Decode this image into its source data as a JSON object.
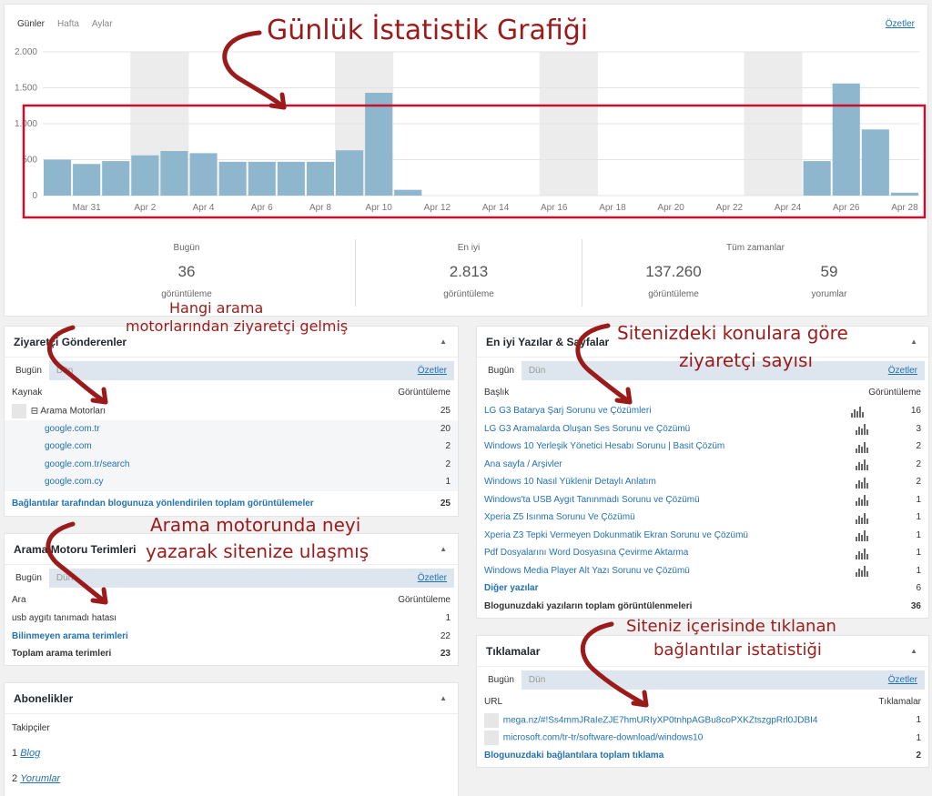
{
  "chart": {
    "range_tabs": [
      "Günler",
      "Hafta",
      "Aylar"
    ],
    "summaries_link": "Özetler",
    "chart_data": {
      "type": "bar",
      "y_ticks": [
        "2.000",
        "1.500",
        "1.000",
        "500",
        "0"
      ],
      "ylim": [
        0,
        2000
      ],
      "x_tick_labels": [
        "Mar 31",
        "Apr 2",
        "Apr 4",
        "Apr 6",
        "Apr 8",
        "Apr 10",
        "Apr 12",
        "Apr 14",
        "Apr 16",
        "Apr 18",
        "Apr 20",
        "Apr 22",
        "Apr 24",
        "Apr 26",
        "Apr 28"
      ],
      "values": [
        500,
        440,
        480,
        560,
        620,
        590,
        470,
        470,
        470,
        470,
        630,
        1430,
        80,
        0,
        0,
        0,
        0,
        0,
        0,
        0,
        0,
        0,
        0,
        0,
        0,
        0,
        480,
        1560,
        920,
        40
      ],
      "grid": true,
      "bar_color": "#8eb6cc",
      "weekend_shade_color": "#ececec",
      "highlight_box_color": "#c8102e"
    },
    "stats": {
      "today_label": "Bugün",
      "today_value": "36",
      "today_unit": "görüntüleme",
      "best_label": "En iyi",
      "best_value": "2.813",
      "best_unit": "görüntüleme",
      "all_label": "Tüm zamanlar",
      "all_views_value": "137.260",
      "all_views_unit": "görüntüleme",
      "all_comments_value": "59",
      "all_comments_unit": "yorumlar"
    }
  },
  "referrers": {
    "title": "Ziyaretçi Gönderenler",
    "tab_today": "Bugün",
    "tab_yesterday": "Dün",
    "summaries": "Özetler",
    "col_source": "Kaynak",
    "col_views": "Görüntüleme",
    "group_label": "⊟ Arama Motorları",
    "group_value": "25",
    "rows": [
      {
        "label": "google.com.tr",
        "value": "20"
      },
      {
        "label": "google.com",
        "value": "2"
      },
      {
        "label": "google.com.tr/search",
        "value": "2"
      },
      {
        "label": "google.com.cy",
        "value": "1"
      }
    ],
    "total_label": "Bağlantılar tarafından blogunuza yönlendirilen toplam görüntülemeler",
    "total_value": "25"
  },
  "search_terms": {
    "title": "Arama Motoru Terimleri",
    "tab_today": "Bugün",
    "tab_yesterday": "Dün",
    "summaries": "Özetler",
    "col_search": "Ara",
    "col_views": "Görüntüleme",
    "term": "usb aygıtı tanımadı hatası",
    "term_value": "1",
    "unknown_label": "Bilinmeyen arama terimleri",
    "unknown_value": "22",
    "total_label": "Toplam arama terimleri",
    "total_value": "23"
  },
  "subscriptions": {
    "title": "Abonelikler",
    "followers_label": "Takipçiler",
    "item1_num": "1",
    "item1_link": "Blog",
    "item2_num": "2",
    "item2_link": "Yorumlar"
  },
  "top_posts": {
    "title": "En iyi Yazılar & Sayfalar",
    "tab_today": "Bugün",
    "tab_yesterday": "Dün",
    "summaries": "Özetler",
    "col_title": "Başlık",
    "col_views": "Görüntüleme",
    "rows": [
      {
        "label": "LG G3 Batarya Şarj Sorunu ve Çözümleri",
        "value": "16"
      },
      {
        "label": "LG G3 Aramalarda Oluşan Ses Sorunu ve Çözümü",
        "value": "3"
      },
      {
        "label": "Windows 10 Yerleşik Yönetici Hesabı Sorunu | Basit Çözüm",
        "value": "2"
      },
      {
        "label": "Ana sayfa / Arşivler",
        "value": "2"
      },
      {
        "label": "Windows 10 Nasıl Yüklenir Detaylı Anlatım",
        "value": "2"
      },
      {
        "label": "Windows'ta USB Aygıt Tanınmadı Sorunu ve Çözümü",
        "value": "1"
      },
      {
        "label": "Xperia Z5 Isınma Sorunu Ve Çözümü",
        "value": "1"
      },
      {
        "label": "Xperia Z3 Tepki Vermeyen Dokunmatik Ekran Sorunu ve Çözümü",
        "value": "1"
      },
      {
        "label": "Pdf Dosyalarını Word Dosyasına Çevirme Aktarma",
        "value": "1"
      },
      {
        "label": "Windows Media Player Alt Yazı Sorunu ve Çözümü",
        "value": "1"
      }
    ],
    "other_label": "Diğer yazılar",
    "other_value": "6",
    "total_label": "Blogunuzdaki yazıların toplam görüntülenmeleri",
    "total_value": "36"
  },
  "clicks": {
    "title": "Tıklamalar",
    "tab_today": "Bugün",
    "tab_yesterday": "Dün",
    "summaries": "Özetler",
    "col_url": "URL",
    "col_clicks": "Tıklamalar",
    "rows": [
      {
        "label": "mega.nz/#!Ss4mmJRaIeZJE7hmURIyXP0tnhpAGBu8coPXKZtszgpRrl0JDBI4",
        "value": "1"
      },
      {
        "label": "microsoft.com/tr-tr/software-download/windows10",
        "value": "1"
      }
    ],
    "total_label": "Blogunuzdaki bağlantılara toplam tıklama",
    "total_value": "2"
  },
  "annotations": {
    "chart": "Günlük İstatistik Grafiği",
    "referrers_line1": "Hangi arama",
    "referrers_line2": "motorlarından ziyaretçi gelmiş",
    "search_line1": "Arama motorunda neyi",
    "search_line2": "yazarak sitenize ulaşmış",
    "posts_line1": "Sitenizdeki konulara göre",
    "posts_line2": "ziyaretçi sayısı",
    "clicks_line1": "Siteniz içerisinde tıklanan",
    "clicks_line2": "bağlantılar istatistiği",
    "color": "#9b1b1b"
  }
}
